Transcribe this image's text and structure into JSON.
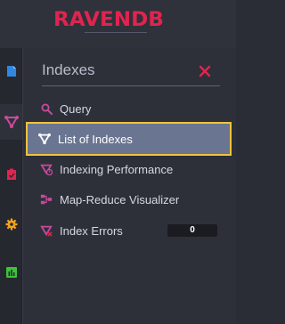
{
  "brand": {
    "logo_text": "RAVENDB",
    "color": "#e0244f"
  },
  "rail": {
    "items": [
      {
        "icon": "document-icon",
        "color": "#2f87e0"
      },
      {
        "icon": "indexes-icon",
        "color": "#c94a9c",
        "active": true
      },
      {
        "icon": "clipboard-icon",
        "color": "#e0244f"
      },
      {
        "icon": "gear-icon",
        "color": "#f2a31b"
      },
      {
        "icon": "chart-icon",
        "color": "#3ec13b"
      }
    ]
  },
  "flyout": {
    "title": "Indexes",
    "close_icon": "close-icon",
    "items": [
      {
        "label": "Query",
        "icon": "search-icon"
      },
      {
        "label": "List of Indexes",
        "icon": "indexes-icon",
        "selected": true
      },
      {
        "label": "Indexing Performance",
        "icon": "indexing-performance-icon"
      },
      {
        "label": "Map-Reduce Visualizer",
        "icon": "map-reduce-icon"
      },
      {
        "label": "Index Errors",
        "icon": "index-errors-icon",
        "badge": "0"
      }
    ]
  },
  "colors": {
    "accent_pink": "#e0244f",
    "selection_bg": "#6a7591",
    "selection_border": "#f3c23d"
  }
}
